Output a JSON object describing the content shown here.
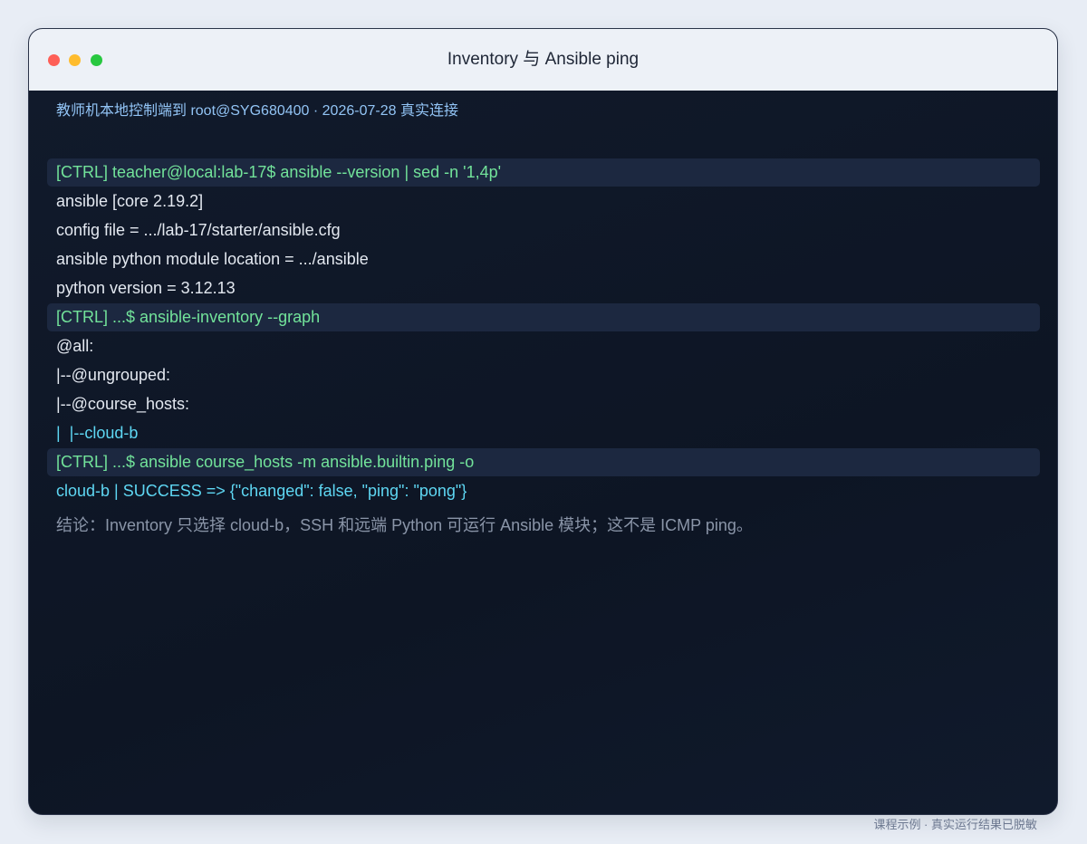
{
  "window": {
    "title": "Inventory 与 Ansible ping"
  },
  "terminal": {
    "subtitle": "教师机本地控制端到 root@SYG680400 · 2026-07-28 真实连接",
    "lines": [
      {
        "text": "[CTRL] teacher@local:lab-17$ ansible --version | sed -n '1,4p'",
        "kind": "command"
      },
      {
        "text": "ansible [core 2.19.2]",
        "kind": "output"
      },
      {
        "text": "config file = .../lab-17/starter/ansible.cfg",
        "kind": "output"
      },
      {
        "text": "ansible python module location = .../ansible",
        "kind": "output"
      },
      {
        "text": "python version = 3.12.13",
        "kind": "output"
      },
      {
        "text": "[CTRL] ...$ ansible-inventory --graph",
        "kind": "command"
      },
      {
        "text": "@all:",
        "kind": "output"
      },
      {
        "text": "|--@ungrouped:",
        "kind": "output"
      },
      {
        "text": "|--@course_hosts:",
        "kind": "output"
      },
      {
        "text": "|  |--cloud-b",
        "kind": "highlight"
      },
      {
        "text": "[CTRL] ...$ ansible course_hosts -m ansible.builtin.ping -o",
        "kind": "command"
      },
      {
        "text": "cloud-b | SUCCESS => {\"changed\": false, \"ping\": \"pong\"}",
        "kind": "highlight"
      }
    ],
    "conclusion": "结论：Inventory 只选择 cloud-b，SSH 和远端 Python 可运行 Ansible 模块；这不是 ICMP ping。"
  },
  "footer": {
    "caption": "课程示例 · 真实运行结果已脱敏"
  },
  "colors": {
    "command": "#72e39a",
    "highlight": "#5ed7f3",
    "output": "#e3e8f0",
    "subtitle": "#92c4f5"
  }
}
